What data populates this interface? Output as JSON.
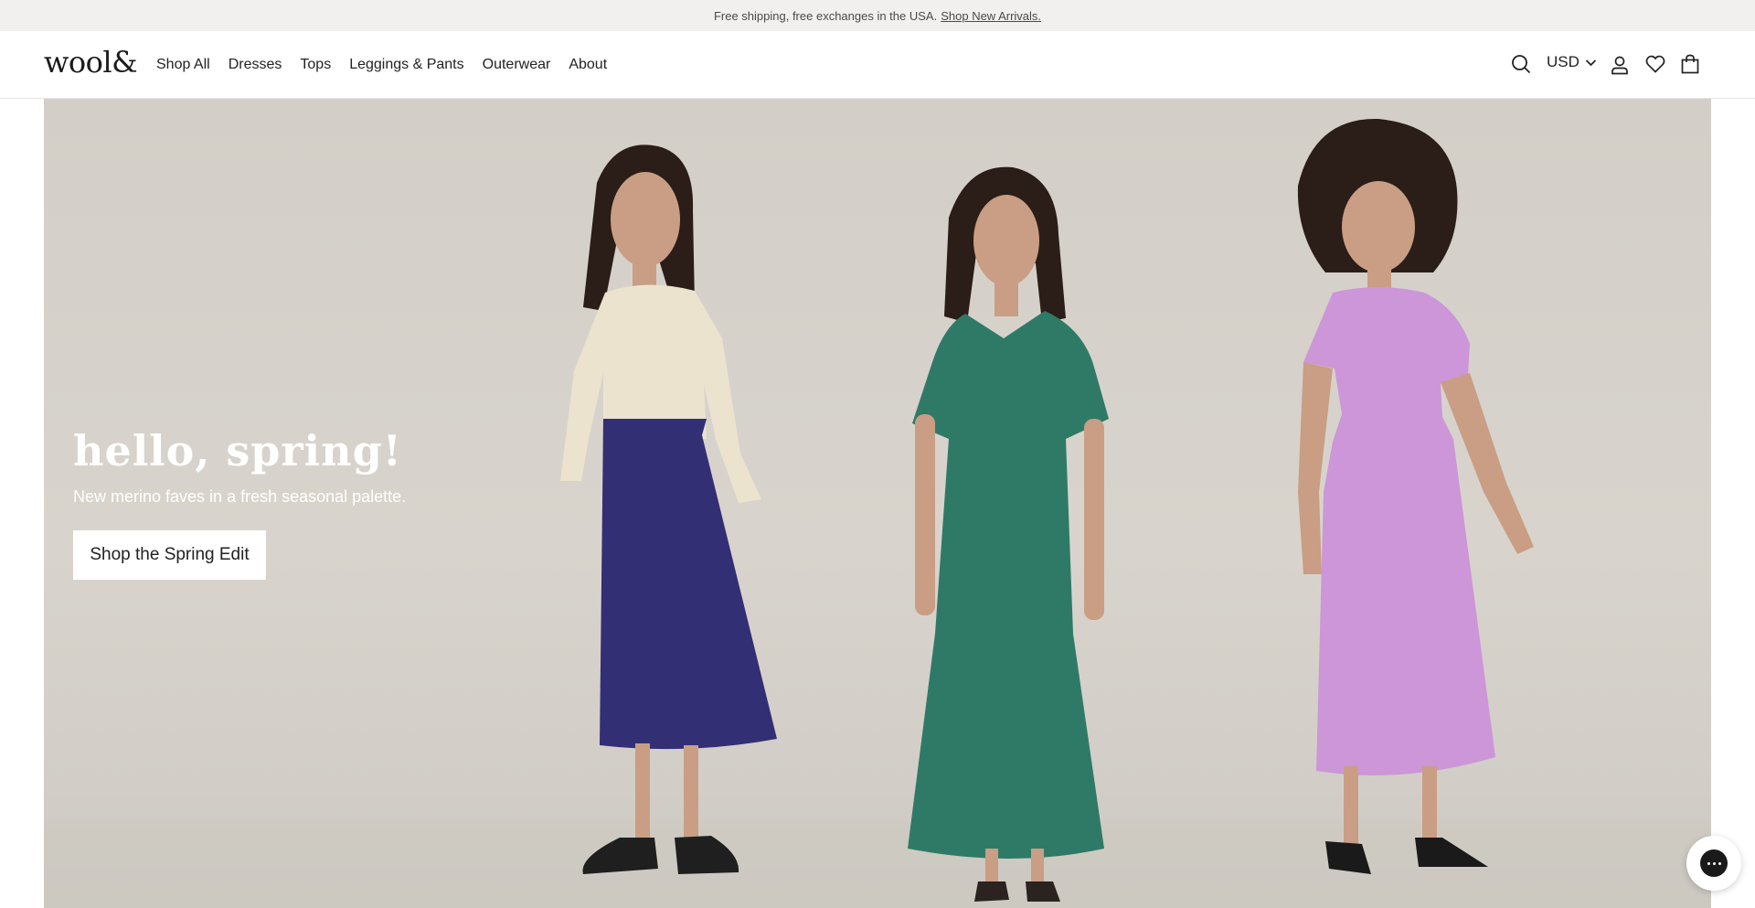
{
  "announcement": {
    "text": "Free shipping, free exchanges in the USA.",
    "link": "Shop New Arrivals."
  },
  "header": {
    "logo": "wool&",
    "nav": [
      {
        "label": "Shop All"
      },
      {
        "label": "Dresses"
      },
      {
        "label": "Tops"
      },
      {
        "label": "Leggings & Pants"
      },
      {
        "label": "Outerwear"
      },
      {
        "label": "About"
      }
    ],
    "currency": "USD",
    "icons": [
      "search-icon",
      "chevron-down-icon",
      "account-icon",
      "heart-icon",
      "bag-icon"
    ]
  },
  "hero": {
    "title": "hello, spring!",
    "subtitle": "New merino faves in a fresh seasonal palette.",
    "cta": "Shop the Spring Edit",
    "colors": {
      "background": "#d5d1ca",
      "sweater": "#ece3cf",
      "skirt": "#322f75",
      "green_dress": "#2f7a66",
      "lilac_dress": "#cc96d8",
      "skin": "#c99e84",
      "hair": "#2b1d17"
    }
  },
  "chat": {
    "icon": "chat-icon"
  }
}
